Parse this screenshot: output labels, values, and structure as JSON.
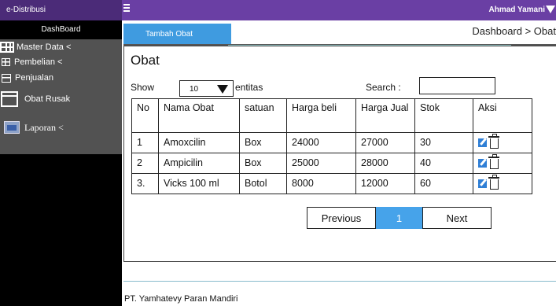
{
  "app": {
    "brand": "e-Distribusi",
    "user": "Ahmad Yamani"
  },
  "sidebar": {
    "header": "DashBoard",
    "items": [
      {
        "label": "Master Data <",
        "icon": "grid-icon"
      },
      {
        "label": "Pembelian  <",
        "icon": "small-grid-icon"
      },
      {
        "label": "Penjualan",
        "icon": "box-icon"
      },
      {
        "label": "Obat Rusak",
        "icon": "box-icon"
      },
      {
        "label": "Laporan  <",
        "icon": "report-icon"
      }
    ]
  },
  "header": {
    "tab_label": "Tambah Obat",
    "breadcrumb": "Dashboard > Obat"
  },
  "panel": {
    "title": "Obat",
    "show_label": "Show",
    "page_length": "10",
    "entitas_label": "entitas",
    "search_label": "Search :",
    "search_value": ""
  },
  "table": {
    "headers": [
      "No",
      "Nama Obat",
      "satuan",
      "Harga beli",
      "Harga Jual",
      "Stok",
      "Aksi"
    ],
    "rows": [
      [
        "1",
        "Amoxcilin",
        "Box",
        "24000",
        "27000",
        "30"
      ],
      [
        "2",
        "Ampicilin",
        "Box",
        "25000",
        "28000",
        "40"
      ],
      [
        "3.",
        "Vicks 100 ml",
        "Botol",
        "8000",
        "12000",
        "60"
      ]
    ]
  },
  "pagination": {
    "previous": "Previous",
    "current": "1",
    "next": "Next"
  },
  "footer": {
    "text": "PT. Yamhatevy Paran Mandiri"
  },
  "colors": {
    "topbar": "#6a3fa4",
    "brand_bg": "#4b2b78",
    "sidebar_gray": "#525252",
    "accent_blue": "#3f9be0"
  }
}
